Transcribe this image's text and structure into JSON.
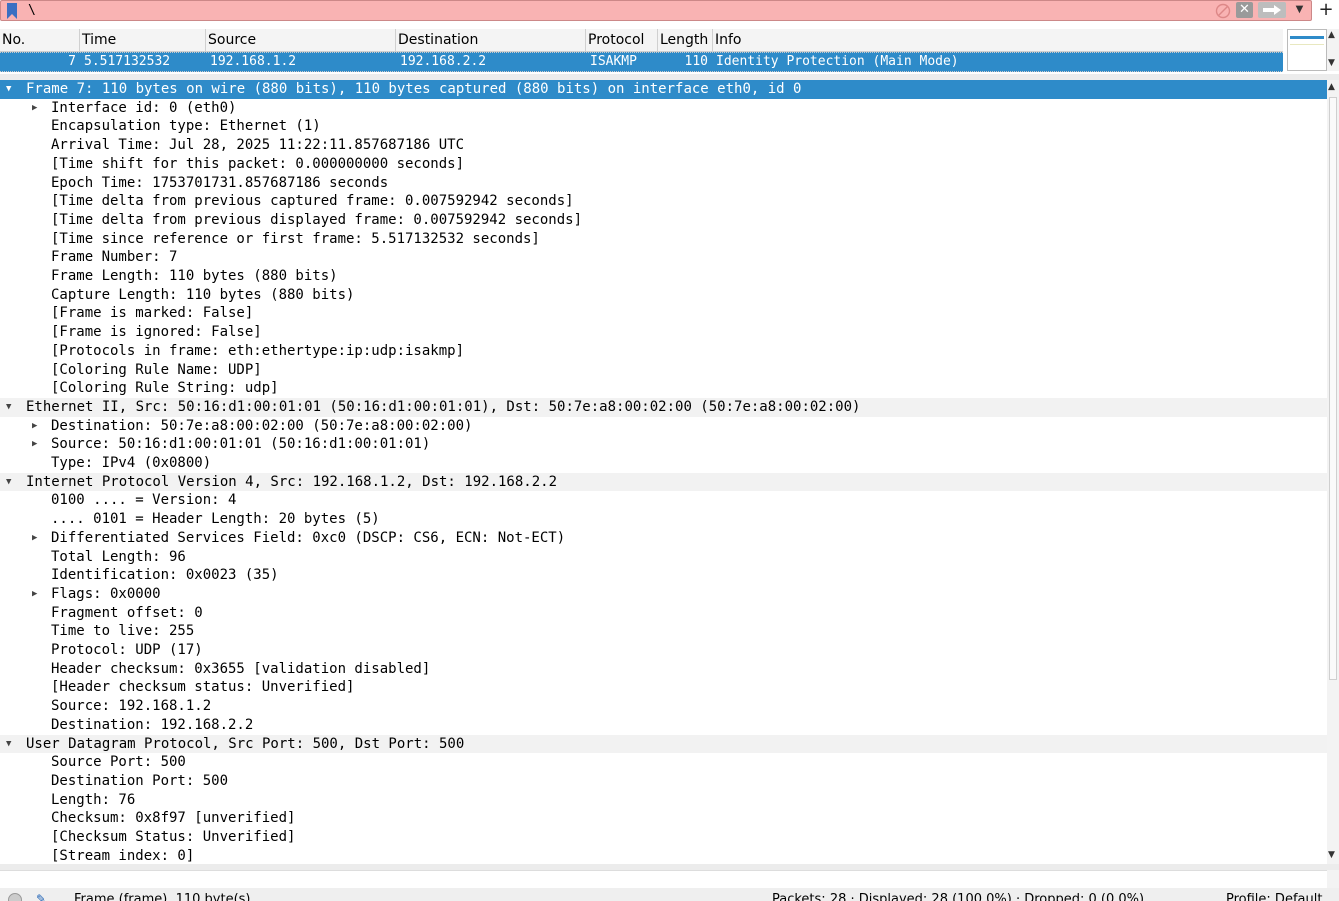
{
  "filter": {
    "value": "\\"
  },
  "packet_list": {
    "columns": [
      "No.",
      "Time",
      "Source",
      "Destination",
      "Protocol",
      "Length",
      "Info"
    ],
    "rows": [
      {
        "no": "7",
        "time": "5.517132532",
        "source": "192.168.1.2",
        "destination": "192.168.2.2",
        "protocol": "ISAKMP",
        "length": "110",
        "info": "Identity Protection (Main Mode)"
      }
    ]
  },
  "tree": [
    {
      "text": "Frame 7: 110 bytes on wire (880 bits), 110 bytes captured (880 bits) on interface eth0, id 0"
    },
    {
      "text": "Interface id: 0 (eth0)"
    },
    {
      "text": "Encapsulation type: Ethernet (1)"
    },
    {
      "text": "Arrival Time: Jul 28, 2025 11:22:11.857687186 UTC"
    },
    {
      "text": "[Time shift for this packet: 0.000000000 seconds]"
    },
    {
      "text": "Epoch Time: 1753701731.857687186 seconds"
    },
    {
      "text": "[Time delta from previous captured frame: 0.007592942 seconds]"
    },
    {
      "text": "[Time delta from previous displayed frame: 0.007592942 seconds]"
    },
    {
      "text": "[Time since reference or first frame: 5.517132532 seconds]"
    },
    {
      "text": "Frame Number: 7"
    },
    {
      "text": "Frame Length: 110 bytes (880 bits)"
    },
    {
      "text": "Capture Length: 110 bytes (880 bits)"
    },
    {
      "text": "[Frame is marked: False]"
    },
    {
      "text": "[Frame is ignored: False]"
    },
    {
      "text": "[Protocols in frame: eth:ethertype:ip:udp:isakmp]"
    },
    {
      "text": "[Coloring Rule Name: UDP]"
    },
    {
      "text": "[Coloring Rule String: udp]"
    },
    {
      "text": "Ethernet II, Src: 50:16:d1:00:01:01 (50:16:d1:00:01:01), Dst: 50:7e:a8:00:02:00 (50:7e:a8:00:02:00)"
    },
    {
      "text": "Destination: 50:7e:a8:00:02:00 (50:7e:a8:00:02:00)"
    },
    {
      "text": "Source: 50:16:d1:00:01:01 (50:16:d1:00:01:01)"
    },
    {
      "text": "Type: IPv4 (0x0800)"
    },
    {
      "text": "Internet Protocol Version 4, Src: 192.168.1.2, Dst: 192.168.2.2"
    },
    {
      "text": "0100 .... = Version: 4"
    },
    {
      "text": ".... 0101 = Header Length: 20 bytes (5)"
    },
    {
      "text": "Differentiated Services Field: 0xc0 (DSCP: CS6, ECN: Not-ECT)"
    },
    {
      "text": "Total Length: 96"
    },
    {
      "text": "Identification: 0x0023 (35)"
    },
    {
      "text": "Flags: 0x0000"
    },
    {
      "text": "Fragment offset: 0"
    },
    {
      "text": "Time to live: 255"
    },
    {
      "text": "Protocol: UDP (17)"
    },
    {
      "text": "Header checksum: 0x3655 [validation disabled]"
    },
    {
      "text": "[Header checksum status: Unverified]"
    },
    {
      "text": "Source: 192.168.1.2"
    },
    {
      "text": "Destination: 192.168.2.2"
    },
    {
      "text": "User Datagram Protocol, Src Port: 500, Dst Port: 500"
    },
    {
      "text": "Source Port: 500"
    },
    {
      "text": "Destination Port: 500"
    },
    {
      "text": "Length: 76"
    },
    {
      "text": "Checksum: 0x8f97 [unverified]"
    },
    {
      "text": "[Checksum Status: Unverified]"
    },
    {
      "text": "[Stream index: 0]"
    }
  ],
  "status": {
    "frame_info": "Frame (frame), 110 byte(s)",
    "packets": "Packets: 28 · Displayed: 28 (100.0%) · Dropped: 0 (0.0%)",
    "profile": "Profile: Default"
  },
  "colors": {
    "selected": "#2e8bc9",
    "filter_invalid": "#f9b3b3"
  },
  "icons": [
    "bookmark-icon",
    "clear-filter-icon",
    "close-icon",
    "apply-arrow-icon",
    "chevron-down-icon",
    "plus-icon",
    "expand-arrow-icon",
    "collapse-arrow-icon",
    "status-led-icon",
    "edit-comment-icon"
  ]
}
